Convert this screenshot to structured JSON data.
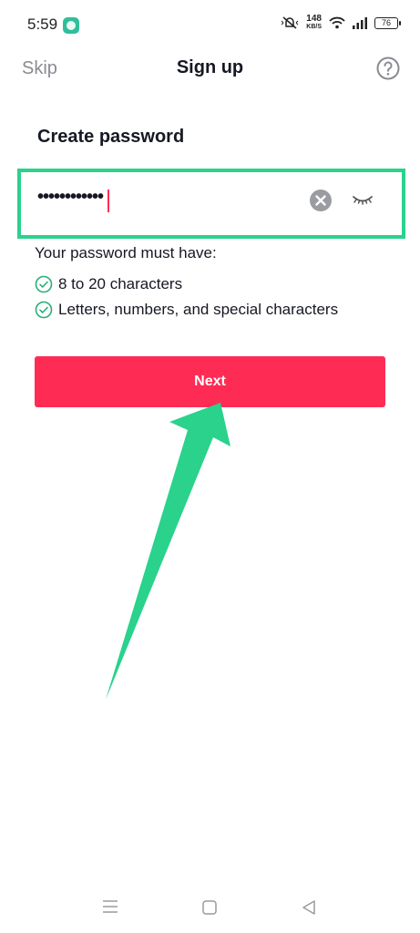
{
  "status_bar": {
    "time": "5:59",
    "net_speed_value": "148",
    "net_speed_unit": "KB/S",
    "battery": "76"
  },
  "header": {
    "skip_label": "Skip",
    "title": "Sign up"
  },
  "form": {
    "section_title": "Create password",
    "password_masked": "••••••••••••",
    "requirements_title": "Your password must have:",
    "requirements": [
      "8 to 20 characters",
      "Letters, numbers, and special characters"
    ],
    "next_label": "Next"
  },
  "colors": {
    "accent": "#fe2c55",
    "highlight": "#2ad28c",
    "check": "#2bae77"
  },
  "icons": [
    "app-notification-icon",
    "mute-icon",
    "wifi-icon",
    "signal-icon",
    "battery-icon",
    "help-icon",
    "clear-icon",
    "eye-closed-icon",
    "check-circle-icon",
    "menu-icon",
    "home-icon",
    "back-icon"
  ]
}
